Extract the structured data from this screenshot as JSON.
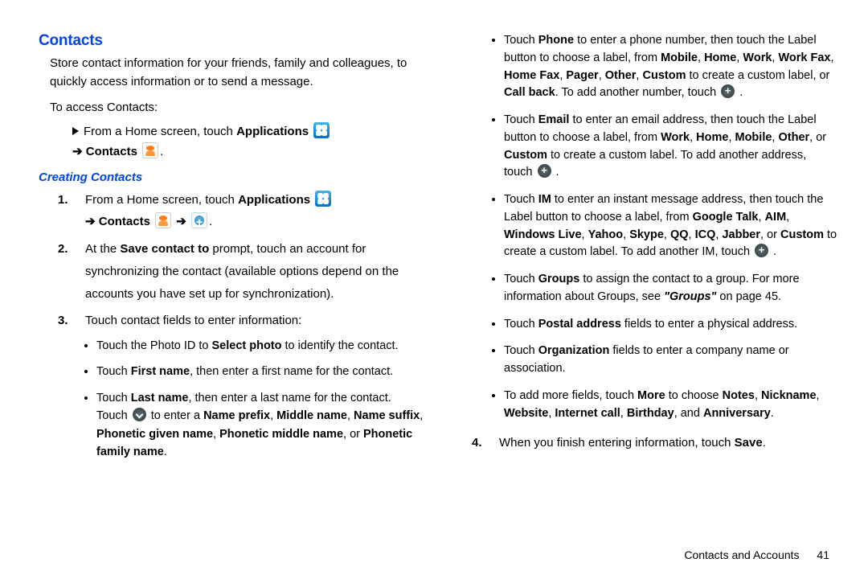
{
  "section_title": "Contacts",
  "intro": "Store contact information for your friends, family and colleagues, to quickly access information or to send a message.",
  "access_line": "To access Contacts:",
  "access_step": {
    "pre": "From a Home screen, touch ",
    "applications": "Applications",
    "contacts": "Contacts"
  },
  "subsection_title": "Creating Contacts",
  "step1": {
    "num": "1.",
    "pre": "From a Home screen, touch ",
    "applications": "Applications",
    "contacts": "Contacts"
  },
  "step2": {
    "num": "2.",
    "t0": "At the ",
    "b0": "Save contact to",
    "t1": " prompt, touch an account for synchronizing the contact (available options depend on the accounts you have set up for synchronization)."
  },
  "step3": {
    "num": "3.",
    "text": "Touch contact fields to enter information:"
  },
  "b_photo": {
    "t0": "Touch the Photo ID to ",
    "b0": "Select photo",
    "t1": " to identify the contact."
  },
  "b_first": {
    "t0": "Touch ",
    "b0": "First name",
    "t1": ", then enter a first name for the contact."
  },
  "b_last": {
    "t0": "Touch ",
    "b0": "Last name",
    "t1": ", then enter a last name for the contact. Touch ",
    "t2": " to enter a ",
    "b1": "Name prefix",
    "sep": ", ",
    "b2": "Middle name",
    "b3": "Name suffix",
    "b4": "Phonetic given name",
    "b5": "Phonetic middle name",
    "or": ", or ",
    "b6": "Phonetic family name",
    "dot": "."
  },
  "r_phone": {
    "t0": "Touch ",
    "b0": "Phone",
    "t1": " to enter a phone number, then touch the Label button to choose a label, from ",
    "b1": "Mobile",
    "b2": "Home",
    "b3": "Work",
    "b4": "Work Fax",
    "b5": "Home Fax",
    "b6": "Pager",
    "b7": "Other",
    "b8": "Custom",
    "t2": " to create a custom label, or ",
    "b9": "Call back",
    "t3": ". To add another number, touch ",
    "sep": ", "
  },
  "r_email": {
    "t0": "Touch ",
    "b0": "Email",
    "t1": " to enter an email address, then touch the Label button to choose a label, from ",
    "b1": "Work",
    "b2": "Home",
    "b3": "Mobile",
    "b4": "Other",
    "or": ", or ",
    "b5": "Custom",
    "t2": " to create a custom label. To add another address, touch ",
    "sep": ", "
  },
  "r_im": {
    "t0": "Touch ",
    "b0": "IM",
    "t1": " to enter an instant message address, then touch the Label button to choose a label, from ",
    "b1": "Google Talk",
    "b2": "AIM",
    "b3": "Windows Live",
    "b4": "Yahoo",
    "b5": "Skype",
    "b6": "QQ",
    "b7": "ICQ",
    "b8": "Jabber",
    "or": ", or ",
    "b9": "Custom",
    "t2": " to create a custom label. To add another IM, touch ",
    "sep": ", "
  },
  "r_groups": {
    "t0": "Touch ",
    "b0": "Groups",
    "t1": " to assign the contact to a group. For more information about Groups, see ",
    "ref": "\"Groups\"",
    "t2": " on page 45."
  },
  "r_postal": {
    "t0": "Touch ",
    "b0": "Postal address",
    "t1": " fields to enter a physical address."
  },
  "r_org": {
    "t0": "Touch ",
    "b0": "Organization",
    "t1": " fields to enter a company name or association."
  },
  "r_more": {
    "t0": "To add more fields, touch ",
    "b0": "More",
    "t1": " to choose ",
    "b1": "Notes",
    "b2": "Nickname",
    "b3": "Website",
    "b4": "Internet call",
    "b5": "Birthday",
    "and": ", and ",
    "b6": "Anniversary",
    "sep": ", ",
    "dot": "."
  },
  "step4": {
    "num": "4.",
    "t0": "When you finish entering information, touch ",
    "b0": "Save",
    "dot": "."
  },
  "footer": {
    "section": "Contacts and Accounts",
    "page": "41"
  }
}
